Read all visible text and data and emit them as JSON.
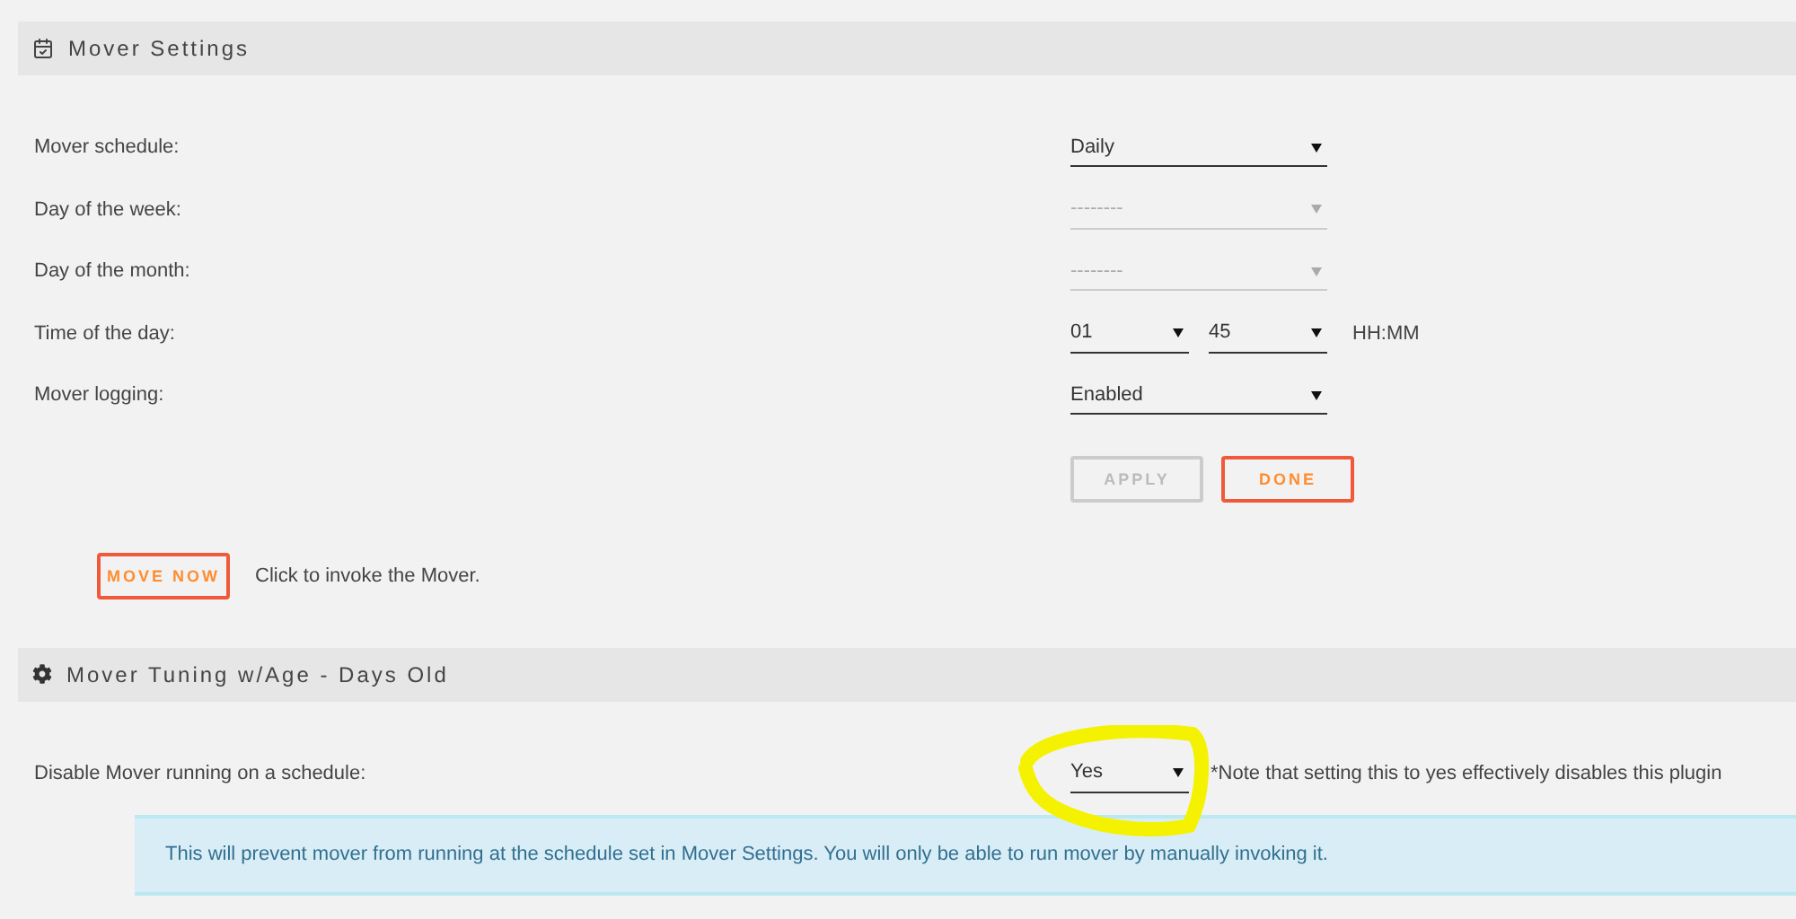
{
  "settings_panel": {
    "title": "Mover Settings",
    "rows": [
      {
        "kind": "select",
        "label": "Mover schedule:",
        "value": "Daily",
        "disabled": false
      },
      {
        "kind": "select",
        "label": "Day of the week:",
        "value": "--------",
        "disabled": true
      },
      {
        "kind": "select",
        "label": "Day of the month:",
        "value": "--------",
        "disabled": true
      },
      {
        "kind": "time",
        "label": "Time of the day:",
        "hours": "01",
        "minutes": "45",
        "format": "HH:MM"
      },
      {
        "kind": "select",
        "label": "Mover logging:",
        "value": "Enabled",
        "disabled": false
      }
    ],
    "buttons": [
      {
        "label": "APPLY",
        "disabled": true
      },
      {
        "label": "DONE",
        "disabled": false
      }
    ],
    "move_now": {
      "label": "MOVE NOW",
      "hint": "Click to invoke the Mover."
    }
  },
  "tuning_panel": {
    "title": "Mover Tuning w/Age - Days Old",
    "rows": [
      {
        "kind": "select",
        "label": "Disable Mover running on a schedule:",
        "value": "Yes",
        "note": "*Note that setting this to yes effectively disables this plugin",
        "highlighted": true
      }
    ],
    "info": "This will prevent mover from running at the schedule set in Mover Settings. You will only be able to run mover by manually invoking it."
  }
}
